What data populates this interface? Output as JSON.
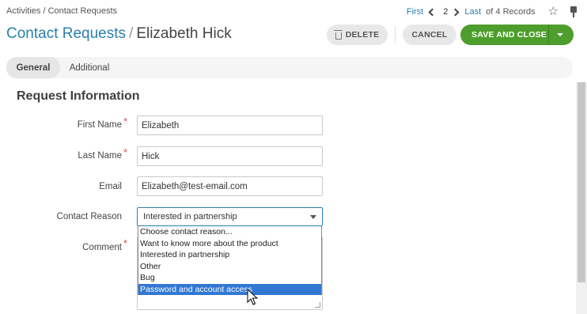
{
  "breadcrumb": "Activities / Contact Requests",
  "pager": {
    "first": "First",
    "current": "2",
    "last": "Last",
    "count": "of 4 Records"
  },
  "header": {
    "entity": "Contact Requests",
    "separator": "/",
    "record_name": "Elizabeth Hick"
  },
  "actions": {
    "delete": "DELETE",
    "cancel": "CANCEL",
    "save_and_close": "SAVE AND CLOSE"
  },
  "tabs": [
    {
      "label": "General",
      "active": true
    },
    {
      "label": "Additional",
      "active": false
    }
  ],
  "section": {
    "title": "Request Information"
  },
  "fields": {
    "first_name": {
      "label": "First Name",
      "value": "Elizabeth",
      "required": "*"
    },
    "last_name": {
      "label": "Last Name",
      "value": "Hick",
      "required": "*"
    },
    "email": {
      "label": "Email",
      "value": "Elizabeth@test-email.com"
    },
    "contact_reason": {
      "label": "Contact Reason",
      "value": "Interested in partnership"
    },
    "comment": {
      "label": "Comment",
      "required": "*"
    }
  },
  "contact_reason_options": [
    "Choose contact reason...",
    "Want to know more about the product",
    "Interested in partnership",
    "Other",
    "Bug",
    "Password and account access"
  ],
  "highlighted_option": "Password and account access",
  "colors": {
    "accent": "#2a7fad",
    "save_green": "#4d9e2c",
    "highlight": "#3278d3",
    "required": "#d9534f"
  },
  "icons": [
    "chevron-left-icon",
    "chevron-right-icon",
    "star-icon",
    "pin-icon",
    "trash-icon",
    "caret-down-icon",
    "mouse-cursor-icon"
  ]
}
